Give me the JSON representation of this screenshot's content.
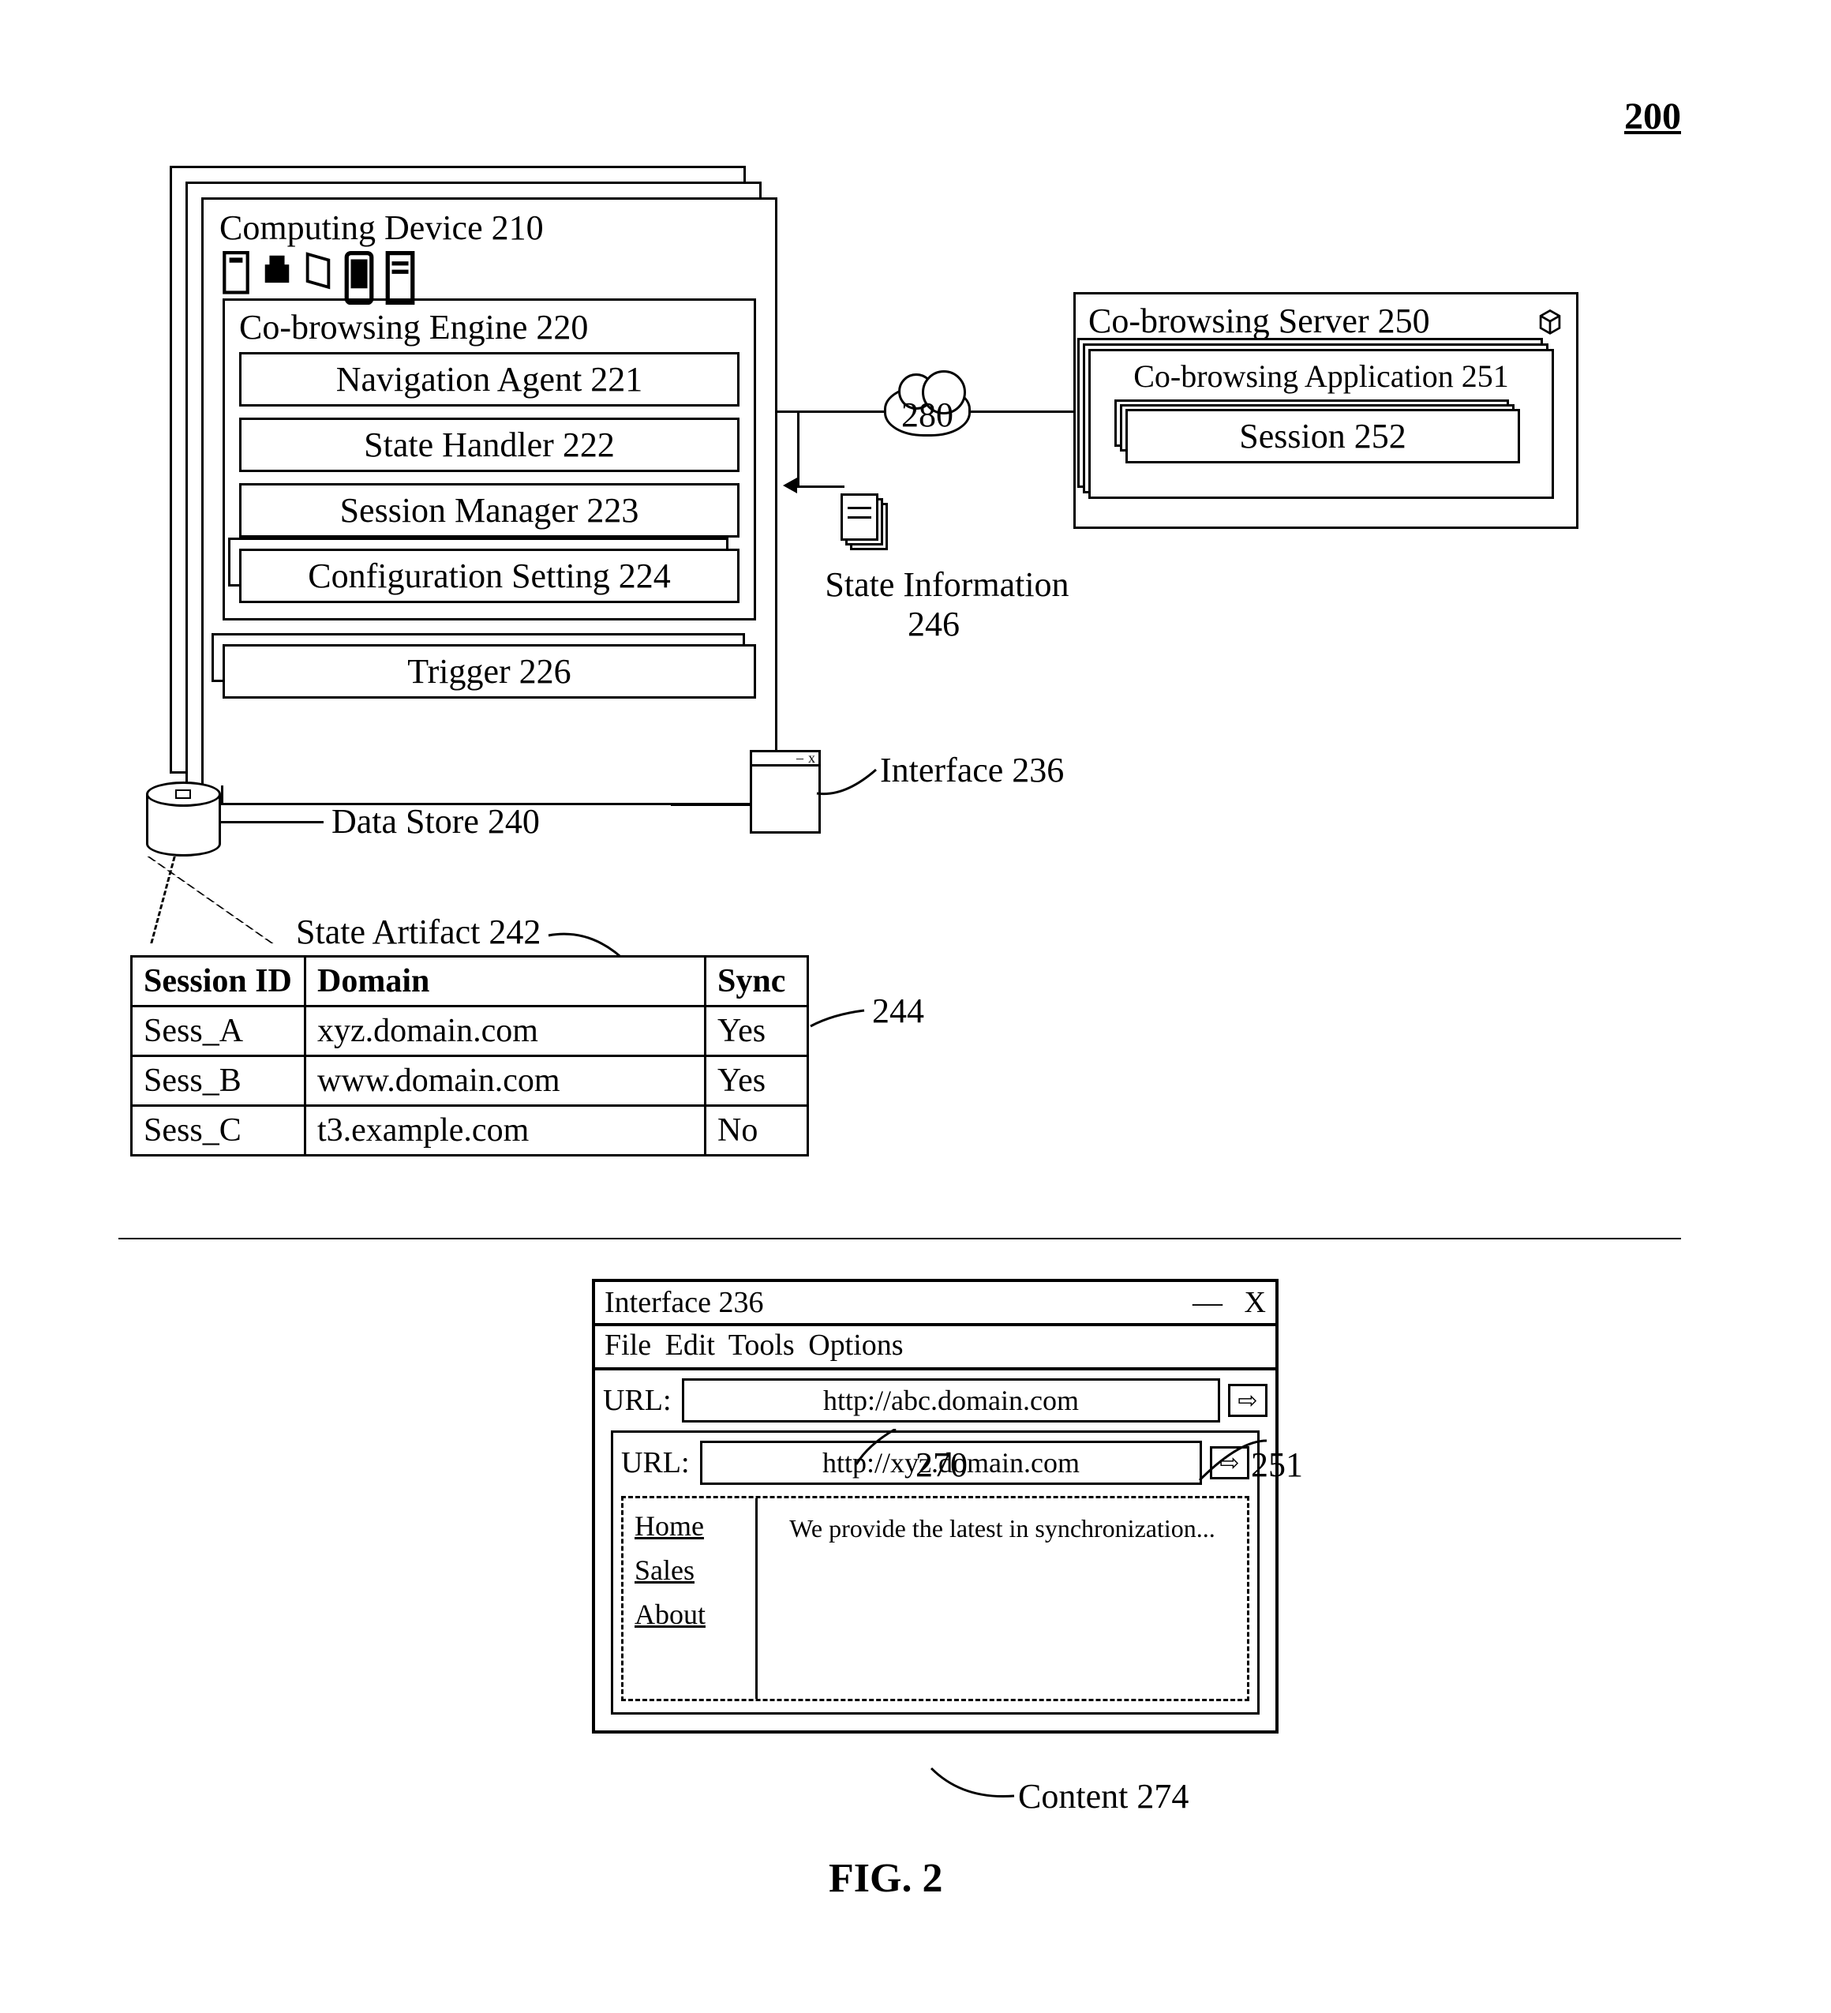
{
  "figure_number": "200",
  "figure_caption": "FIG. 2",
  "top": {
    "computing_device": {
      "title": "Computing Device 210",
      "engine": {
        "title": "Co-browsing Engine 220",
        "items": [
          "Navigation Agent 221",
          "State Handler 222",
          "Session Manager 223",
          "Configuration Setting 224"
        ],
        "trigger": "Trigger 226"
      }
    },
    "data_store_label": "Data Store 240",
    "interface_label": "Interface 236",
    "state_info_label_l1": "State Information",
    "state_info_label_l2": "246",
    "cloud_label": "280",
    "server": {
      "title": "Co-browsing Server 250",
      "app": "Co-browsing Application 251",
      "session": "Session 252"
    },
    "artifact": {
      "title": "State Artifact 242",
      "callout_244": "244",
      "headers": [
        "Session ID",
        "Domain",
        "Sync"
      ],
      "rows": [
        {
          "sid": "Sess_A",
          "domain": "xyz.domain.com",
          "sync": "Yes"
        },
        {
          "sid": "Sess_B",
          "domain": "www.domain.com",
          "sync": "Yes"
        },
        {
          "sid": "Sess_C",
          "domain": "t3.example.com",
          "sync": "No"
        }
      ]
    }
  },
  "bottom": {
    "title": "Interface 236",
    "min": "—",
    "close": "X",
    "menus": [
      "File",
      "Edit",
      "Tools",
      "Options"
    ],
    "url_label": "URL:",
    "outer_url": "http://abc.domain.com",
    "outer_go": "⇨",
    "callout_270": "270",
    "callout_251": "251",
    "inner_url": "http://xyz.domain.com",
    "inner_go": "⇨",
    "nav": [
      "Home",
      "Sales",
      "About"
    ],
    "body_text": "We provide the latest in synchronization...",
    "content_label": "Content 274"
  }
}
